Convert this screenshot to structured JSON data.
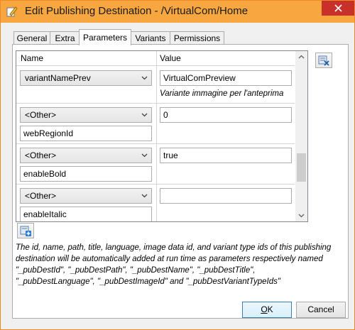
{
  "window": {
    "title": "Edit Publishing Destination - /VirtualCom/Home",
    "app_icon": "pencil-edit-icon",
    "close_icon": "close-icon"
  },
  "tabs": [
    {
      "label": "General",
      "active": false
    },
    {
      "label": "Extra",
      "active": false
    },
    {
      "label": "Parameters",
      "active": true
    },
    {
      "label": "Variants",
      "active": false
    },
    {
      "label": "Permissions",
      "active": false
    }
  ],
  "grid": {
    "columns": [
      "Name",
      "Value"
    ],
    "rows": [
      {
        "name_select": "variantNamePrev",
        "name_input": "",
        "value": "VirtualComPreview",
        "hint": "Variante immagine per l'anteprima"
      },
      {
        "name_select": "<Other>",
        "name_input": "webRegionId",
        "value": "0"
      },
      {
        "name_select": "<Other>",
        "name_input": "enableBold",
        "value": "true"
      },
      {
        "name_select": "<Other>",
        "name_input": "enableItalic",
        "value": ""
      }
    ]
  },
  "buttons": {
    "remove_icon": "remove-parameter-icon",
    "add_icon": "add-parameter-icon",
    "ok_label": "OK",
    "ok_mnemonic": "O",
    "ok_rest": "K",
    "cancel_label": "Cancel"
  },
  "description": "The id, name, path, title, language, image data id, and variant type ids of this publishing destination will be automatically added at run time as parameters respectively named \"_pubDestId\", \"_pubDestPath\", \"_pubDestName\", \"_pubDestTitle\", \"_pubDestLanguage\", \"_pubDestImageId\" and \"_pubDestVariantTypeIds\"",
  "colors": {
    "titlebar": "#f7a640",
    "close": "#c7312a",
    "window_border": "#f08a24"
  }
}
